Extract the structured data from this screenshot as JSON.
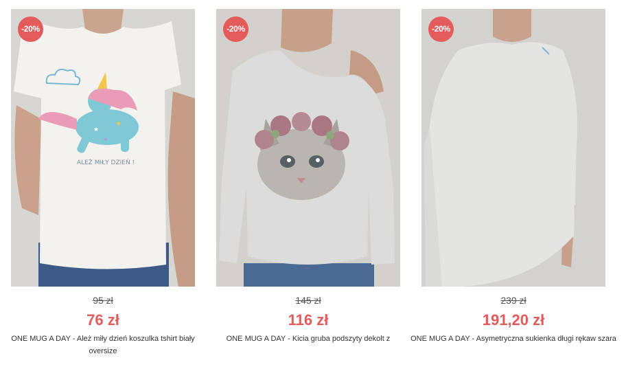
{
  "products": [
    {
      "discount_badge": "-20%",
      "old_price": "95 zł",
      "new_price": "76 zł",
      "name": "ONE MUG A DAY - Ależ miły dzień koszulka tshirt biały oversize",
      "print_text": "ALEŻ MIŁY DZIEŃ !"
    },
    {
      "discount_badge": "-20%",
      "old_price": "145 zł",
      "new_price": "116 zł",
      "name": "ONE MUG A DAY - Kicia gruba podszyty dekolt z"
    },
    {
      "discount_badge": "-20%",
      "old_price": "239 zł",
      "new_price": "191,20 zł",
      "name": "ONE MUG A DAY - Asymetryczna sukienka długi rękaw szara"
    }
  ],
  "colors": {
    "badge": "#e35b5b",
    "price": "#e35b5b",
    "photo_background": "#d6d6d6"
  }
}
